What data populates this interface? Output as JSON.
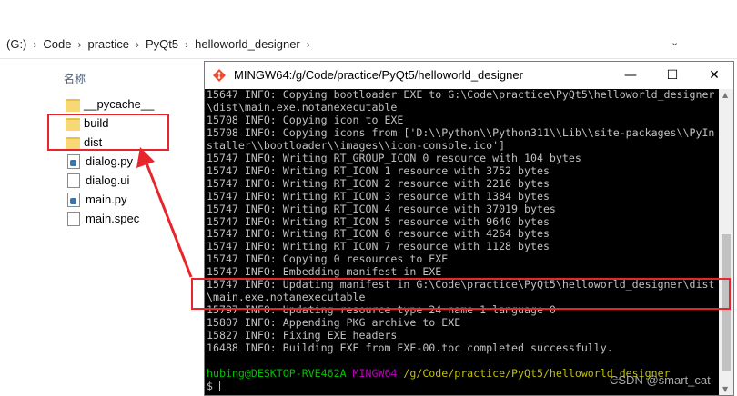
{
  "explorer": {
    "breadcrumb": [
      "(G:)",
      "Code",
      "practice",
      "PyQt5",
      "helloworld_designer"
    ],
    "column_header": "名称",
    "files": [
      {
        "name": "__pycache__",
        "type": "folder"
      },
      {
        "name": "build",
        "type": "folder"
      },
      {
        "name": "dist",
        "type": "folder"
      },
      {
        "name": "dialog.py",
        "type": "py"
      },
      {
        "name": "dialog.ui",
        "type": "doc"
      },
      {
        "name": "main.py",
        "type": "py"
      },
      {
        "name": "main.spec",
        "type": "doc"
      }
    ]
  },
  "terminal": {
    "title": "MINGW64:/g/Code/practice/PyQt5/helloworld_designer",
    "lines": [
      "15647 INFO: Copying bootloader EXE to G:\\Code\\practice\\PyQt5\\helloworld_designer",
      "\\dist\\main.exe.notanexecutable",
      "15708 INFO: Copying icon to EXE",
      "15708 INFO: Copying icons from ['D:\\\\Python\\\\Python311\\\\Lib\\\\site-packages\\\\PyIn",
      "staller\\\\bootloader\\\\images\\\\icon-console.ico']",
      "15747 INFO: Writing RT_GROUP_ICON 0 resource with 104 bytes",
      "15747 INFO: Writing RT_ICON 1 resource with 3752 bytes",
      "15747 INFO: Writing RT_ICON 2 resource with 2216 bytes",
      "15747 INFO: Writing RT_ICON 3 resource with 1384 bytes",
      "15747 INFO: Writing RT_ICON 4 resource with 37019 bytes",
      "15747 INFO: Writing RT_ICON 5 resource with 9640 bytes",
      "15747 INFO: Writing RT_ICON 6 resource with 4264 bytes",
      "15747 INFO: Writing RT_ICON 7 resource with 1128 bytes",
      "15747 INFO: Copying 0 resources to EXE",
      "15747 INFO: Embedding manifest in EXE",
      "15747 INFO: Updating manifest in G:\\Code\\practice\\PyQt5\\helloworld_designer\\dist",
      "\\main.exe.notanexecutable",
      "15797 INFO: Updating resource type 24 name 1 language 0",
      "15807 INFO: Appending PKG archive to EXE",
      "15827 INFO: Fixing EXE headers",
      "16488 INFO: Building EXE from EXE-00.toc completed successfully.",
      ""
    ],
    "prompt_user": "hubing@DESKTOP-RVE462A",
    "prompt_host": "MINGW64",
    "prompt_path": "/g/Code/practice/PyQt5/helloworld_designer",
    "prompt_symbol": "$"
  },
  "watermark": "CSDN @smart_cat",
  "colors": {
    "highlight": "#e8242c",
    "terminal_bg": "#000000"
  }
}
